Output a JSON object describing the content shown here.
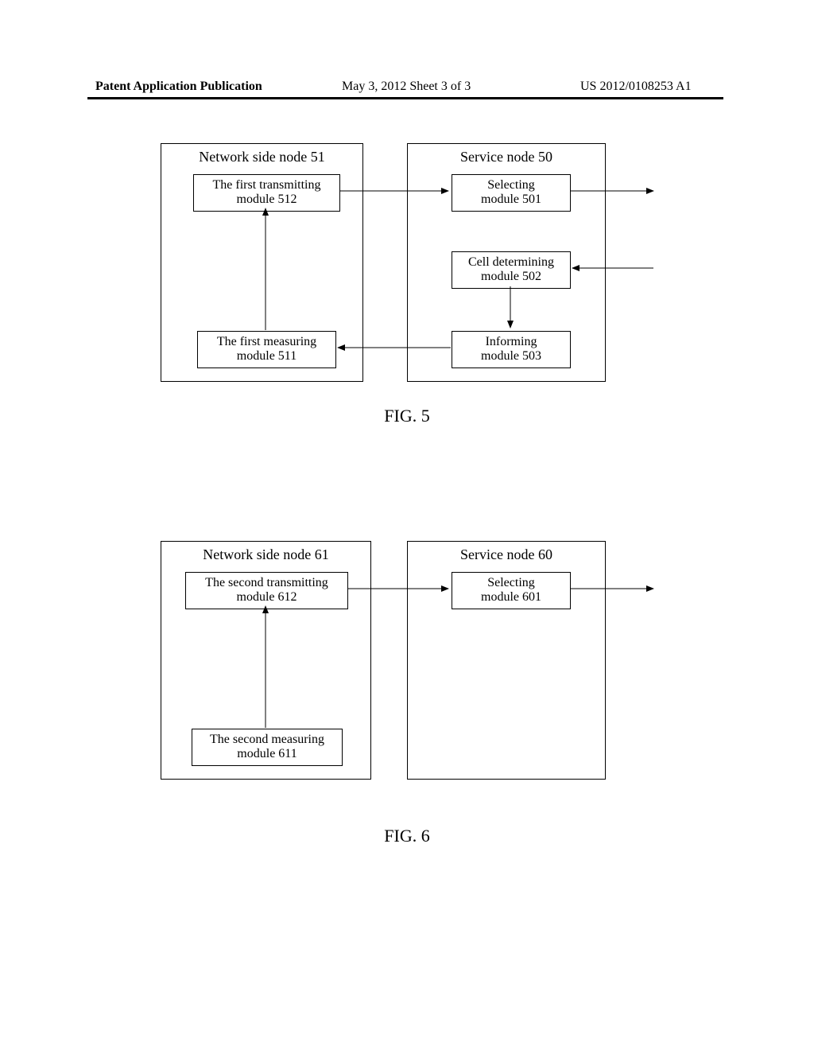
{
  "header": {
    "left": "Patent Application Publication",
    "mid": "May 3, 2012  Sheet 3 of 3",
    "right": "US 2012/0108253 A1"
  },
  "fig5": {
    "caption": "FIG. 5",
    "network_side": {
      "title": "Network side node 51",
      "first_transmitting": "The first transmitting\nmodule 512",
      "first_measuring": "The first measuring\nmodule 511"
    },
    "service": {
      "title": "Service node 50",
      "selecting": "Selecting\nmodule 501",
      "cell_determining": "Cell determining\nmodule 502",
      "informing": "Informing\nmodule 503"
    }
  },
  "fig6": {
    "caption": "FIG. 6",
    "network_side": {
      "title": "Network side node 61",
      "second_transmitting": "The second transmitting\nmodule 612",
      "second_measuring": "The second measuring\nmodule 611"
    },
    "service": {
      "title": "Service node 60",
      "selecting": "Selecting\nmodule 601"
    }
  }
}
